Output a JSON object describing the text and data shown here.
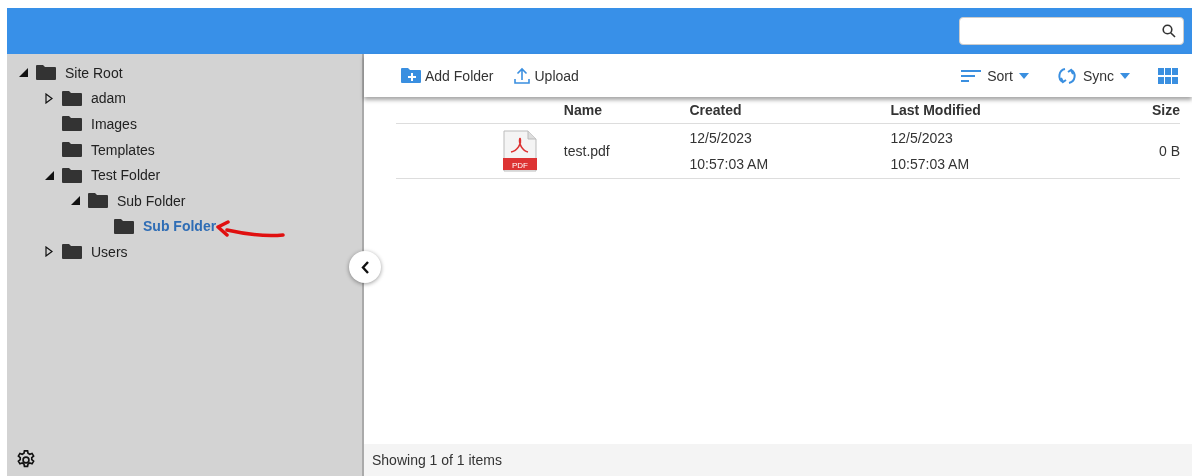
{
  "tree": [
    {
      "label": "Site Root",
      "expanded": true,
      "selected": false,
      "children": [
        {
          "label": "adam",
          "expanded": false,
          "selected": false
        },
        {
          "label": "Images",
          "selected": false
        },
        {
          "label": "Templates",
          "selected": false
        },
        {
          "label": "Test Folder",
          "expanded": true,
          "selected": false,
          "children": [
            {
              "label": "Sub Folder",
              "expanded": true,
              "selected": false,
              "children": [
                {
                  "label": "Sub Folder",
                  "selected": true
                }
              ]
            }
          ]
        },
        {
          "label": "Users",
          "expanded": false,
          "selected": false
        }
      ]
    }
  ],
  "toolbar": {
    "left": [
      {
        "kind": "add-folder",
        "label": "Add Folder"
      },
      {
        "kind": "upload",
        "label": "Upload"
      }
    ],
    "right": [
      {
        "kind": "sort",
        "label": "Sort"
      },
      {
        "kind": "sync",
        "label": "Sync"
      },
      {
        "kind": "grid"
      }
    ]
  },
  "table": {
    "columns": [
      "Name",
      "Created",
      "Last Modified",
      "Size"
    ],
    "rows": [
      {
        "icon_label": "PDF",
        "name": "test.pdf",
        "created": [
          "12/5/2023",
          "10:57:03 AM"
        ],
        "modified": [
          "12/5/2023",
          "10:57:03 AM"
        ],
        "size": "0 B"
      }
    ]
  },
  "status_bar": "Showing 1 of 1 items"
}
